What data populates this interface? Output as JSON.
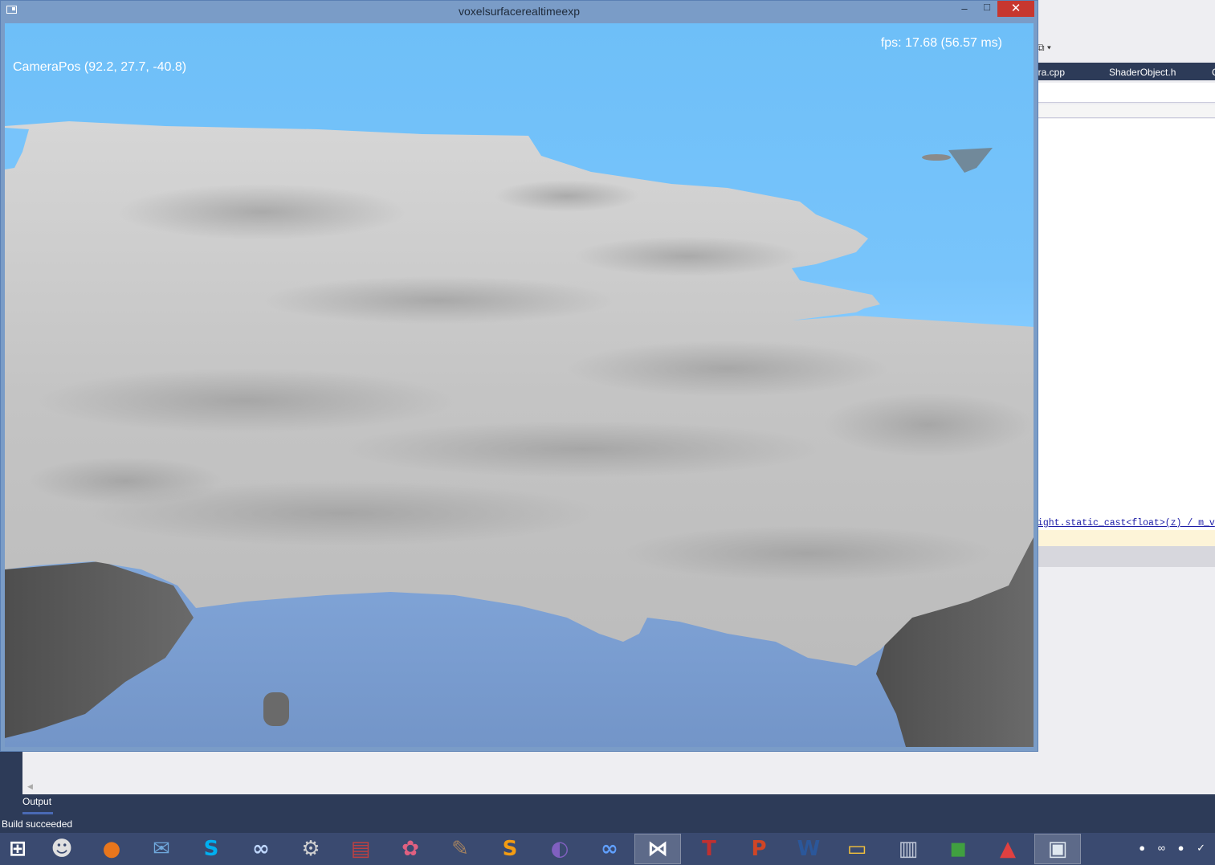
{
  "window": {
    "title": "voxelsurfacerealtimeexp",
    "minimize_glyph": "–",
    "maximize_glyph": "□",
    "close_glyph": "✕"
  },
  "viewport": {
    "fps_text": "fps: 17.68 (56.57 ms)",
    "camera_text": "CameraPos (92.2, 27.7, -40.8)",
    "colors": {
      "sky": "#78c4fb",
      "terrain": "#c9c9c9",
      "terrain_shadow": "#5c5c5c",
      "lower_sky": "#7a9cd0"
    }
  },
  "ide": {
    "tabs": [
      "era.cpp",
      "ShaderObject.h",
      "C"
    ],
    "code_line": "ight.static_cast<float>(z) / m_v",
    "output_tab": "Output",
    "status": "Build succeeded",
    "colors": {
      "chrome": "#2d3b58",
      "editor_bg": "#ffffff"
    }
  },
  "taskbar": {
    "items": [
      {
        "name": "start-button-icon",
        "glyph": "⊞",
        "color": "#ffffff"
      },
      {
        "name": "alien-app-icon",
        "glyph": "☻",
        "color": "#e0e0e0"
      },
      {
        "name": "firefox-icon",
        "glyph": "●",
        "color": "#e8761c"
      },
      {
        "name": "thunderbird-icon",
        "glyph": "✉",
        "color": "#6fa8dc"
      },
      {
        "name": "skype-icon",
        "glyph": "S",
        "color": "#00aff0"
      },
      {
        "name": "chain-app-icon",
        "glyph": "∞",
        "color": "#c0d8ff"
      },
      {
        "name": "steam-icon",
        "glyph": "⚙",
        "color": "#d0d0d0"
      },
      {
        "name": "keyboard-app-icon",
        "glyph": "▤",
        "color": "#c04040"
      },
      {
        "name": "paint-app-icon",
        "glyph": "✿",
        "color": "#e06080"
      },
      {
        "name": "gimp-icon",
        "glyph": "✎",
        "color": "#a08060"
      },
      {
        "name": "sublime-text-icon",
        "glyph": "S",
        "color": "#f39c12"
      },
      {
        "name": "eclipse-icon",
        "glyph": "◐",
        "color": "#8060c0"
      },
      {
        "name": "infinity-app-icon",
        "glyph": "∞",
        "color": "#60a0ff"
      },
      {
        "name": "visual-studio-icon",
        "glyph": "⋈",
        "color": "#ffffff"
      },
      {
        "name": "texmaker-icon",
        "glyph": "T",
        "color": "#c03030"
      },
      {
        "name": "powerpoint-icon",
        "glyph": "P",
        "color": "#d04525"
      },
      {
        "name": "word-icon",
        "glyph": "W",
        "color": "#2b579a"
      },
      {
        "name": "file-explorer-icon",
        "glyph": "▭",
        "color": "#f5c33b"
      },
      {
        "name": "system-monitor-icon",
        "glyph": "▥",
        "color": "#c0c8d8"
      },
      {
        "name": "green-app-icon",
        "glyph": "◼",
        "color": "#40a040"
      },
      {
        "name": "triangle-app-icon",
        "glyph": "▲",
        "color": "#e04040"
      },
      {
        "name": "window-app-icon",
        "glyph": "▣",
        "color": "#dfe8f0"
      }
    ],
    "active_index": 21,
    "tray": "● ∞ ● ✓"
  }
}
